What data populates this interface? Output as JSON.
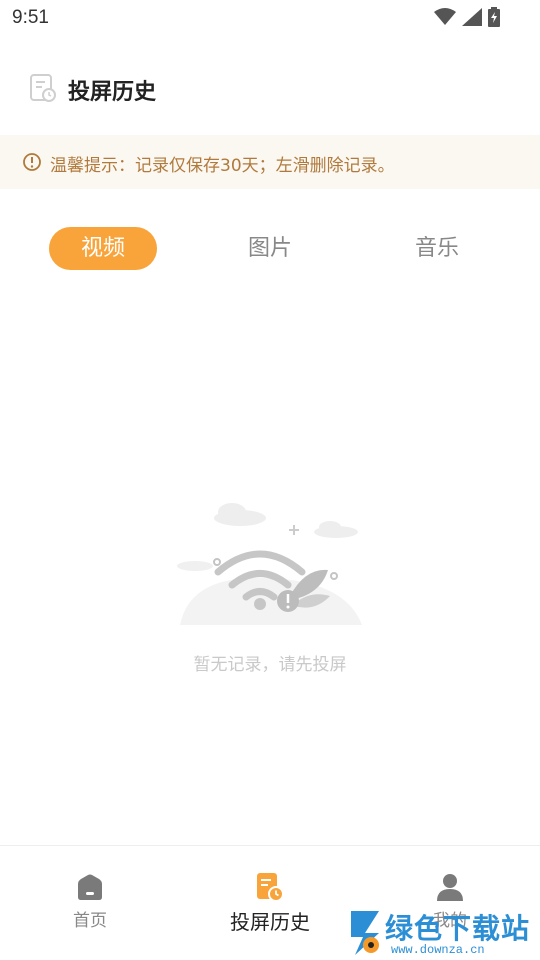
{
  "status_bar": {
    "time": "9:51",
    "icons": [
      "wifi-icon",
      "signal-icon",
      "battery-icon"
    ]
  },
  "header": {
    "title": "投屏历史",
    "icon": "history-doc-icon"
  },
  "notice": {
    "icon": "info-icon",
    "text": "温馨提示：记录仅保存30天；左滑删除记录。"
  },
  "tabs": [
    {
      "label": "视频",
      "active": true
    },
    {
      "label": "图片",
      "active": false
    },
    {
      "label": "音乐",
      "active": false
    }
  ],
  "empty_state": {
    "text": "暂无记录，请先投屏",
    "illustration": "no-signal-illustration"
  },
  "bottom_nav": [
    {
      "label": "首页",
      "icon": "home-icon",
      "active": false
    },
    {
      "label": "投屏历史",
      "icon": "history-icon",
      "active": true
    },
    {
      "label": "我的",
      "icon": "user-icon",
      "active": false
    }
  ],
  "colors": {
    "accent": "#f9a43a",
    "notice_bg": "#fbf7f1",
    "notice_text": "#b07a3c",
    "inactive": "#888888"
  },
  "watermark": {
    "text": "绿色下载站",
    "url": "www.downza.cn"
  }
}
